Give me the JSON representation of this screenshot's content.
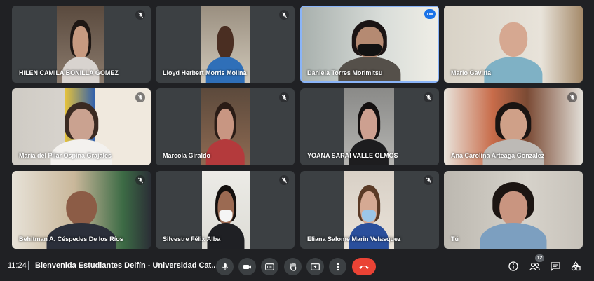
{
  "participants": [
    {
      "name": "HILEN CAMILA BONILLA GOMEZ",
      "muted": true
    },
    {
      "name": "Lloyd Herbert Morris Molina",
      "muted": true
    },
    {
      "name": "Daniela Torres Morimitsu",
      "muted": false,
      "active": true
    },
    {
      "name": "Mario Gaviria",
      "muted": false
    },
    {
      "name": "Maria del Pilar Ospina Grajales",
      "muted": true
    },
    {
      "name": "Marcola Giraldo",
      "muted": true
    },
    {
      "name": "YOANA SARAI VALLE OLMOS",
      "muted": true
    },
    {
      "name": "Ana Carolina Arteaga Gonzalez",
      "muted": true
    },
    {
      "name": "Behitman A. Céspedes De los Ríos",
      "muted": true
    },
    {
      "name": "Silvestre Félix Alba",
      "muted": true
    },
    {
      "name": "Eliana Salome Marin Velasquez",
      "muted": true
    },
    {
      "name": "Tú",
      "muted": false
    }
  ],
  "bottom_bar": {
    "time": "11:24",
    "meeting_title": "Bienvenida Estudiantes Delfín - Universidad Cat...",
    "participant_count": "12",
    "icons": {
      "mic": "mic-icon",
      "camera": "camera-icon",
      "captions": "captions-icon",
      "raise_hand": "raise-hand-icon",
      "present": "present-screen-icon",
      "more": "more-options-icon",
      "end_call": "end-call-icon",
      "info": "info-icon",
      "people": "people-icon",
      "chat": "chat-icon",
      "activities": "activities-icon"
    }
  },
  "colors": {
    "background": "#202124",
    "tile": "#3c4043",
    "end_call": "#ea4335",
    "active_border": "#8ab4f8",
    "menu_dot": "#1a73e8"
  }
}
